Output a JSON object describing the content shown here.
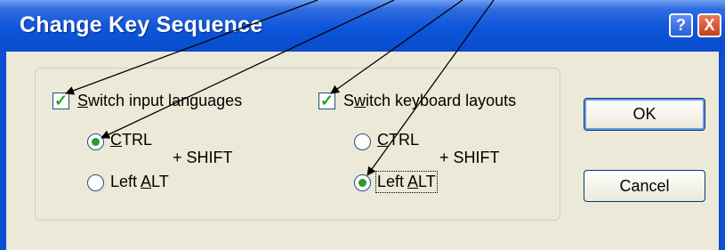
{
  "window": {
    "title": "Change Key Sequence",
    "help_label": "?",
    "close_label": "X"
  },
  "left_group": {
    "checkbox_label_pre": "",
    "checkbox_label_ul": "S",
    "checkbox_label_post": "witch input languages",
    "checked": true,
    "ctrl_ul": "C",
    "ctrl_rest": "TRL",
    "plus_shift": "+  SHIFT",
    "leftalt_pre": "Left ",
    "leftalt_ul": "A",
    "leftalt_post": "LT",
    "selected": "CTRL"
  },
  "right_group": {
    "checkbox_label_pre": "S",
    "checkbox_label_ul": "w",
    "checkbox_label_post": "itch keyboard layouts",
    "checked": true,
    "ctrl_ul": "C",
    "ctrl_rest": "TRL",
    "plus_shift": "+  SHIFT",
    "leftalt_pre": "Left ",
    "leftalt_ul": "A",
    "leftalt_post": "LT",
    "selected": "Left ALT"
  },
  "buttons": {
    "ok": "OK",
    "cancel": "Cancel"
  },
  "colors": {
    "titlebar": "#0a4ccd",
    "client": "#ece9d8",
    "check": "#21a121",
    "radio_dot": "#2a9a2a"
  },
  "icons": [
    "check-icon",
    "help-icon",
    "close-icon"
  ]
}
